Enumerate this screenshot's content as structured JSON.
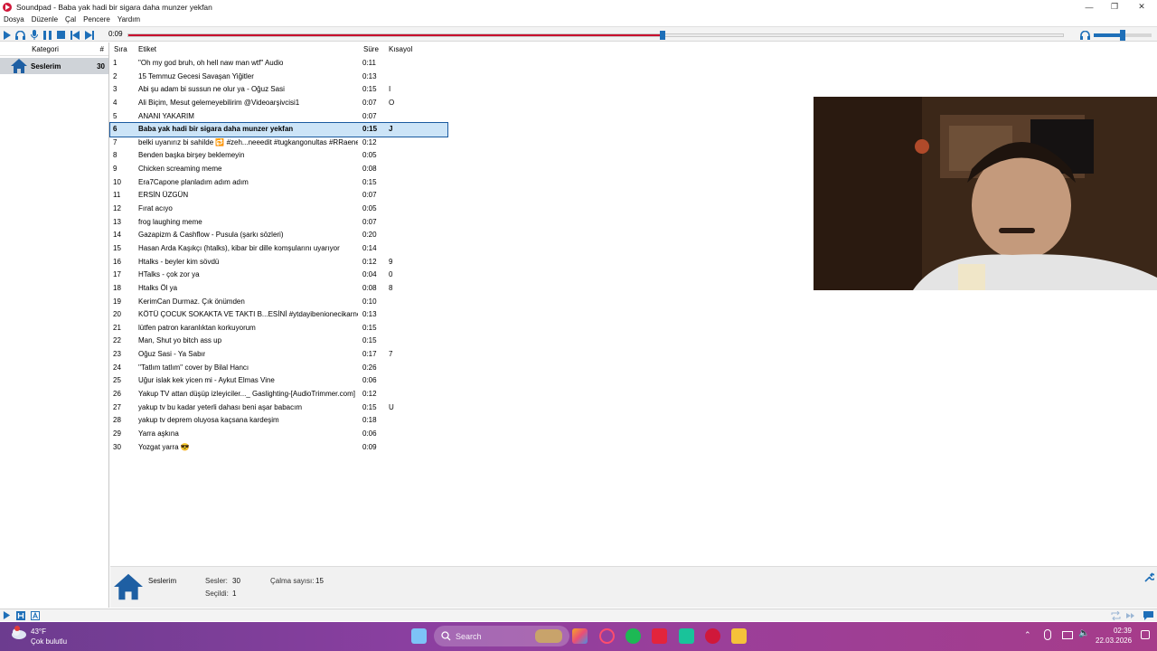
{
  "window": {
    "title": "Soundpad - Baba yak hadi bir sigara daha munzer yekfan"
  },
  "menu": [
    "Dosya",
    "Düzenle",
    "Çal",
    "Pencere",
    "Yardım"
  ],
  "player": {
    "elapsed": "0:09",
    "progress": 0.572,
    "volume": 0.5
  },
  "categories": {
    "header_label": "Kategori",
    "header_count": "#",
    "items": [
      {
        "label": "Seslerim",
        "count": "30"
      }
    ]
  },
  "columns": {
    "order": "Sıra",
    "label": "Etiket",
    "duration": "Süre",
    "hotkey": "Kısayol"
  },
  "sounds": [
    {
      "n": "1",
      "label": "\"Oh my god bruh, oh hell naw man wtf\" Audio",
      "dur": "0:11",
      "key": ""
    },
    {
      "n": "2",
      "label": "15 Temmuz Gecesi Savaşan Yiğitler",
      "dur": "0:13",
      "key": ""
    },
    {
      "n": "3",
      "label": "Abi şu adam bi sussun ne olur ya - Oğuz Sasi",
      "dur": "0:15",
      "key": "I"
    },
    {
      "n": "4",
      "label": "Ali Biçim, Mesut gelemeyebilirim @Videoarşivcisi1",
      "dur": "0:07",
      "key": "O"
    },
    {
      "n": "5",
      "label": "ANANI YAKARIM",
      "dur": "0:07",
      "key": ""
    },
    {
      "n": "6",
      "label": "Baba yak hadi bir sigara daha munzer yekfan",
      "dur": "0:15",
      "key": "J"
    },
    {
      "n": "7",
      "label": "belki uyanırız bi sahilde 🔁 #zeh...neeedit #tugkangonultas #RRaenee",
      "dur": "0:12",
      "key": ""
    },
    {
      "n": "8",
      "label": "Benden başka birşey beklemeyin",
      "dur": "0:05",
      "key": ""
    },
    {
      "n": "9",
      "label": "Chicken screaming meme",
      "dur": "0:08",
      "key": ""
    },
    {
      "n": "10",
      "label": "Era7Capone planladım adım adım",
      "dur": "0:15",
      "key": ""
    },
    {
      "n": "11",
      "label": "ERSİN ÜZGÜN",
      "dur": "0:07",
      "key": ""
    },
    {
      "n": "12",
      "label": "Fırat acıyo",
      "dur": "0:05",
      "key": ""
    },
    {
      "n": "13",
      "label": "frog laughing meme",
      "dur": "0:07",
      "key": ""
    },
    {
      "n": "14",
      "label": "Gazapizm & Cashflow - Pusula (şarkı sözleri)",
      "dur": "0:20",
      "key": ""
    },
    {
      "n": "15",
      "label": "Hasan Arda Kaşıkçı (htalks), kibar bir dille komşularını uyarıyor",
      "dur": "0:14",
      "key": ""
    },
    {
      "n": "16",
      "label": "Htalks - beyler kim sövdü",
      "dur": "0:12",
      "key": "9"
    },
    {
      "n": "17",
      "label": "HTalks - çok zor ya",
      "dur": "0:04",
      "key": "0"
    },
    {
      "n": "18",
      "label": "Htalks Öl ya",
      "dur": "0:08",
      "key": "8"
    },
    {
      "n": "19",
      "label": "KerimCan Durmaz. Çık önümden",
      "dur": "0:10",
      "key": ""
    },
    {
      "n": "20",
      "label": "KÖTÜ ÇOCUK SOKAKTA VE TAKTI B...ESİNİ #ytdayibenionecikarnolur",
      "dur": "0:13",
      "key": ""
    },
    {
      "n": "21",
      "label": "lütfen patron karanlıktan korkuyorum",
      "dur": "0:15",
      "key": ""
    },
    {
      "n": "22",
      "label": "Man, Shut yo bitch ass up",
      "dur": "0:15",
      "key": ""
    },
    {
      "n": "23",
      "label": "Oğuz Sasi - Ya Sabır",
      "dur": "0:17",
      "key": "7"
    },
    {
      "n": "24",
      "label": "''Tatlım tatlım'' cover by Bilal Hancı",
      "dur": "0:26",
      "key": ""
    },
    {
      "n": "25",
      "label": "Uğur islak kek yicen mi - Aykut Elmas Vine",
      "dur": "0:06",
      "key": ""
    },
    {
      "n": "26",
      "label": "Yakup TV attan düşüp izleyiciler..._ Gaslighting-[AudioTrimmer.com]",
      "dur": "0:12",
      "key": ""
    },
    {
      "n": "27",
      "label": "yakup tv bu kadar yeterli dahası beni aşar babacım",
      "dur": "0:15",
      "key": "U"
    },
    {
      "n": "28",
      "label": "yakup tv deprem oluyosa kaçsana kardeşim",
      "dur": "0:18",
      "key": ""
    },
    {
      "n": "29",
      "label": "Yarra aşkına",
      "dur": "0:06",
      "key": ""
    },
    {
      "n": "30",
      "label": "Yozgat yarra 😎",
      "dur": "0:09",
      "key": ""
    }
  ],
  "selected_index": 5,
  "info": {
    "name": "Seslerim",
    "sounds_label": "Sesler:",
    "sounds_value": "30",
    "selected_label": "Seçildi:",
    "selected_value": "1",
    "plays_label": "Çalma sayısı:",
    "plays_value": "15"
  },
  "taskbar": {
    "temp": "43°F",
    "condition": "Çok bulutlu",
    "search_placeholder": "Search",
    "time": "02:39",
    "date": "22.03.2026"
  },
  "colors": {
    "accent": "#1e6fb8",
    "progress": "#c8102e",
    "selection": "#cce4f7"
  }
}
